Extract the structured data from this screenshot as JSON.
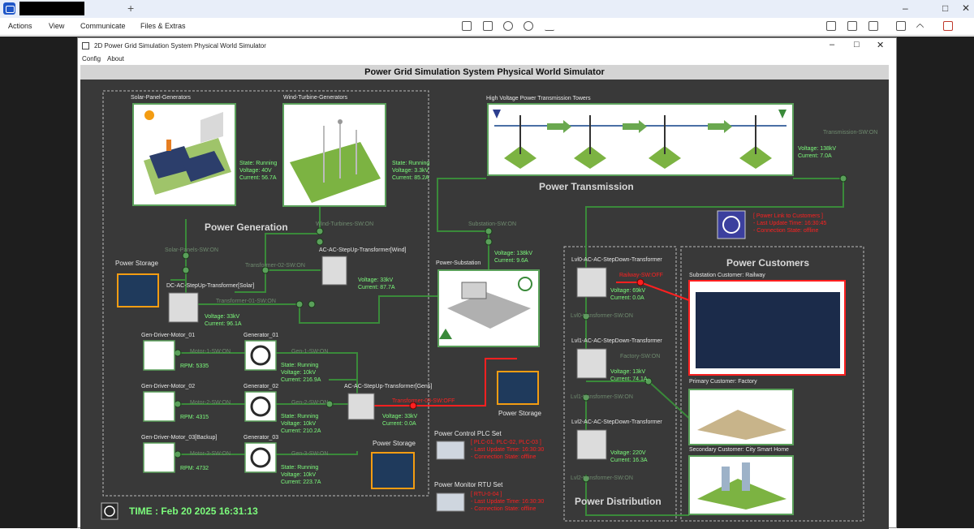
{
  "browser": {
    "new_tab": "+",
    "menu": [
      "Actions",
      "View",
      "Communicate",
      "Files & Extras"
    ]
  },
  "window": {
    "title": "2D Power Grid Simulation System Physical World Simulator",
    "menu": [
      "Config",
      "About"
    ]
  },
  "header": "Power Grid Simulation System Physical World Simulator",
  "sections": {
    "generation": "Power Generation",
    "transmission": "Power Transmission",
    "customers": "Power Customers",
    "distribution": "Power Distribution"
  },
  "solar": {
    "label": "Solar-Panel-Generators",
    "state": "State: Running",
    "voltage": "Voltage: 40V",
    "current": "Current: 56.7A",
    "switch": "Solar-Panels-SW:ON"
  },
  "wind": {
    "label": "Wind-Turbine-Generators",
    "state": "State: Running",
    "voltage": "Voltage: 3.3kV",
    "current": "Current: 85.2A",
    "switch": "Wind-Turbines-SW:ON"
  },
  "storage": {
    "label1": "Power Storage",
    "label2": "Power Storage",
    "label3": "Power Storage"
  },
  "transformers": {
    "wind": {
      "label": "AC-AC-StepUp-Transformer[Wind]",
      "switch": "Transformer-02-SW:ON",
      "voltage": "Voltage: 33kV",
      "current": "Current: 87.7A"
    },
    "solar": {
      "label": "DC-AC-StepUp-Transformer[Solar]",
      "switch": "Transformer-01-SW:ON",
      "voltage": "Voltage: 33kV",
      "current": "Current: 96.1A"
    },
    "gens": {
      "label": "AC-AC-StepUp-Transformer[Gens]",
      "switch": "Transformer-03-SW:OFF",
      "voltage": "Voltage: 33kV",
      "current": "Current: 0.0A"
    }
  },
  "motors": [
    {
      "label": "Gen-Driver-Motor_01",
      "switch": "Motor-1-SW:ON",
      "rpm": "RPM: 5335"
    },
    {
      "label": "Gen-Driver-Motor_02",
      "switch": "Motor-2-SW:ON",
      "rpm": "RPM: 4315"
    },
    {
      "label": "Gen-Driver-Motor_03[Backup]",
      "switch": "Motor-3-SW:ON",
      "rpm": "RPM: 4732"
    }
  ],
  "generators": [
    {
      "label": "Generator_01",
      "switch": "Gen-1-SW:ON",
      "state": "State: Running",
      "voltage": "Voltage: 10kV",
      "current": "Current: 216.9A"
    },
    {
      "label": "Generator_02",
      "switch": "Gen-2-SW:ON",
      "state": "State: Running",
      "voltage": "Voltage: 10kV",
      "current": "Current: 210.2A"
    },
    {
      "label": "Generator_03",
      "switch": "Gen-3-SW:ON",
      "state": "State: Running",
      "voltage": "Voltage: 10kV",
      "current": "Current: 223.7A"
    }
  ],
  "substation": {
    "label": "Power-Substation",
    "switch": "Substation-SW:ON",
    "voltage": "Voltage: 138kV",
    "current": "Current: 9.6A"
  },
  "towers": {
    "label": "High Voltage Power Transmission Towers",
    "switch": "Transmission-SW:ON",
    "voltage": "Voltage: 138kV",
    "current": "Current: 7.0A"
  },
  "customer_link": {
    "line1": "[ Power Link to Customers ]",
    "line2": "- Last Update Time: 16:30:45",
    "line3": "- Connection State: offline"
  },
  "stepdown": [
    {
      "label": "Lvl0-AC-AC-StepDown-Transformer",
      "switch": "Railway-SW:OFF",
      "voltage": "Voltage: 69kV",
      "current": "Current: 0.0A",
      "tswitch": "Lvl0-transformer-SW:ON"
    },
    {
      "label": "Lvl1-AC-AC-StepDown-Transformer",
      "switch": "Factory-SW:ON",
      "voltage": "Voltage: 13kV",
      "current": "Current: 74.1A",
      "tswitch": "Lvl1-transformer-SW:ON"
    },
    {
      "label": "Lvl2-AC-AC-StepDown-Transformer",
      "voltage": "Voltage: 220V",
      "current": "Current: 16.3A",
      "tswitch": "Lvl2-transformer-SW:ON"
    }
  ],
  "customers": {
    "railway": "Substation Customer: Railway",
    "factory": "Primary Customer: Factory",
    "home": "Secondary Customer: City Smart Home"
  },
  "plc": {
    "label": "Power Control PLC Set",
    "line1": "[ PLC-01, PLC-02, PLC-03 ]",
    "line2": "- Last Update Time: 16:30:30",
    "line3": "- Connection State: offline"
  },
  "rtu": {
    "label": "Power Monitor RTU Set",
    "line1": "[ RTU-0-04 ]",
    "line2": "- Last Update Time: 16:30:30",
    "line3": "- Connection State: offline"
  },
  "time": "TIME : Feb 20 2025 16:31:13",
  "colors": {
    "ok": "#7CFC7C",
    "alert": "#ff2020",
    "dim_switch": "#6f8a6f",
    "link": "#3a8a3a"
  }
}
